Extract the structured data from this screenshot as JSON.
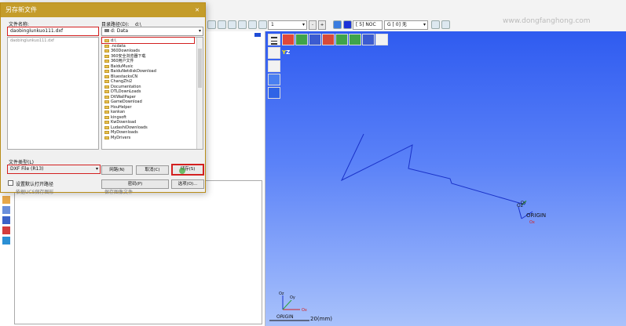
{
  "toolbar": {
    "layer_value": "1",
    "minus_label": "-",
    "plus_label": "+",
    "color_index": "[  5] NOC",
    "group_label": "G [  0] 无",
    "watermark": "www.dongfanghong.com"
  },
  "dialog": {
    "title": "另存新文件",
    "filename_label": "文件名称:",
    "filename_value": "daobinglunkuo111.dxf",
    "directory_label": "目录路径(D):",
    "directory_value": "d:\\",
    "drive_value": "d: Data",
    "file_list": [
      "daobinglunkuo111.dxf"
    ],
    "current_folder": "d:\\",
    "folders": [
      ".ncdata",
      "360Downloads",
      "360安全浏览器下载",
      "360用户文件",
      "BaiduMusic",
      "BaiduNetdiskDownload",
      "BluestacksCN",
      "ChangZhi2",
      "Documentation",
      "DTLDownLoads",
      "DtlWallPaper",
      "GameDownload",
      "HouHelper",
      "kankan",
      "kingsoft",
      "KwDownload",
      "LudashiDownloads",
      "MyDownloads",
      "MyDrivers"
    ],
    "filetype_label": "文件类型(L)",
    "filetype_value": "DXF File (R13)",
    "network_button": "网路(N)",
    "cancel_button": "取消(C)",
    "save_button": "储存(S)",
    "default_checkbox_label": "设置默认打开路径",
    "password_button": "密码(P)",
    "options_button": "选项(O)...",
    "ucs_label": "依据UCS保存图形",
    "save_group_label": "保存图像文件"
  },
  "viewport": {
    "origin_label": "ORIGIN",
    "axis_label_x": "Ox",
    "axis_label_y": "Oy",
    "axis_label_z": "Oz",
    "scale_label": "20(mm)",
    "corner_origin_label": "ORIGIN",
    "corner_x": "Ox",
    "corner_y": "Oy",
    "corner_z": "Oz",
    "view_y_axis": "Y",
    "view_z_axis": "Z",
    "colors": {
      "sky_top": "#2f5bf0",
      "sky_bottom": "#a9c2fb",
      "profile_line": "#1a32c8"
    }
  }
}
